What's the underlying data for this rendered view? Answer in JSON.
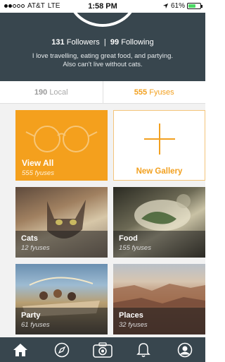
{
  "status_bar": {
    "carrier": "AT&T",
    "network": "LTE",
    "time": "1:58 PM",
    "battery": "61%",
    "battery_level": 0.61
  },
  "profile": {
    "followers_count": "131",
    "followers_label": "Followers",
    "separator": "|",
    "following_count": "99",
    "following_label": "Following",
    "bio_line1": "I love travelling, eating great food, and partying.",
    "bio_line2": "Also can't live without cats."
  },
  "tabs": [
    {
      "count": "190",
      "label": "Local",
      "active": false
    },
    {
      "count": "555",
      "label": "Fyuses",
      "active": true
    }
  ],
  "galleries": {
    "view_all": {
      "title": "View All",
      "sub": "555 fyuses"
    },
    "new_gallery": {
      "title": "New Gallery"
    },
    "items": [
      {
        "title": "Cats",
        "sub": "12 fyuses"
      },
      {
        "title": "Food",
        "sub": "155 fyuses"
      },
      {
        "title": "Party",
        "sub": "61 fyuses"
      },
      {
        "title": "Places",
        "sub": "32 fyuses"
      }
    ]
  },
  "tab_bar": {
    "icons": [
      "home-icon",
      "compass-icon",
      "camera-icon",
      "bell-icon",
      "profile-icon"
    ]
  },
  "colors": {
    "accent": "#f4a01d",
    "header": "#38464e",
    "battery": "#4cd964"
  }
}
